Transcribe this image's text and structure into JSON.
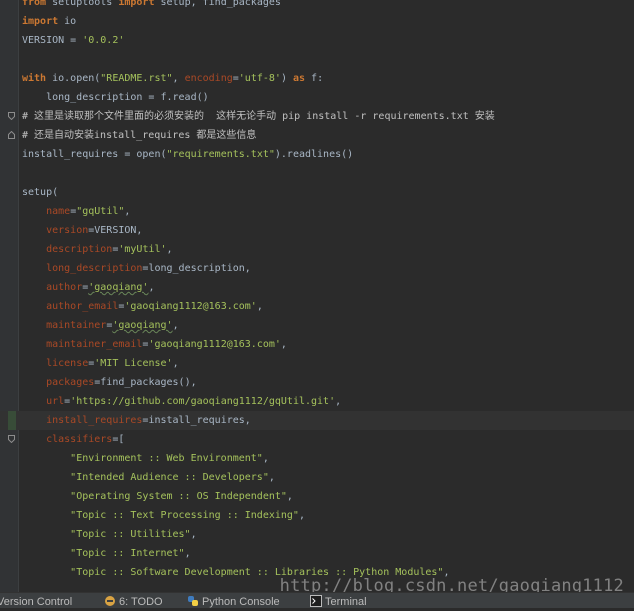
{
  "editor": {
    "lines": {
      "l1": {
        "kw1": "from",
        "t1": " setuptools ",
        "kw2": "import",
        "t2": " setup, find_packages"
      },
      "l2": {
        "kw1": "import",
        "t1": " io"
      },
      "l3": {
        "t1": "VERSION = ",
        "s1": "'0.0.2'"
      },
      "l5": {
        "kw1": "with",
        "t1": " io.open(",
        "s1": "\"README.rst\"",
        "t2": ", ",
        "p1": "encoding",
        "t3": "=",
        "s2": "'utf-8'",
        "t4": ") ",
        "kw2": "as",
        "t5": " f:"
      },
      "l6": {
        "t1": "    long_description = f.read()"
      },
      "l7": {
        "c1": "# 这里是读取那个文件里面的必须安装的  这样无论手动 pip install -r requirements.txt 安装"
      },
      "l8": {
        "c1": "# 还是自动安装install_requires 都是这些信息"
      },
      "l9": {
        "t1": "install_requires = ",
        "b1": "open",
        "t2": "(",
        "s1": "\"requirements.txt\"",
        "t3": ").readlines()"
      },
      "l11": {
        "t1": "setup("
      },
      "l12": {
        "p1": "name",
        "t1": "=",
        "s1": "\"gqUtil\"",
        "t2": ","
      },
      "l13": {
        "p1": "version",
        "t1": "=VERSION,"
      },
      "l14": {
        "p1": "description",
        "t1": "=",
        "s1": "'myUtil'",
        "t2": ","
      },
      "l15": {
        "p1": "long_description",
        "t1": "=long_description,"
      },
      "l16": {
        "p1": "author",
        "t1": "=",
        "s1": "'gaoqiang'",
        "t2": ","
      },
      "l17": {
        "p1": "author_email",
        "t1": "=",
        "s1": "'gaoqiang1112@163.com'",
        "t2": ","
      },
      "l18": {
        "p1": "maintainer",
        "t1": "=",
        "s1": "'gaoqiang'",
        "t2": ","
      },
      "l19": {
        "p1": "maintainer_email",
        "t1": "=",
        "s1": "'gaoqiang1112@163.com'",
        "t2": ","
      },
      "l20": {
        "p1": "license",
        "t1": "=",
        "s1": "'MIT License'",
        "t2": ","
      },
      "l21": {
        "p1": "packages",
        "t1": "=find_packages(),"
      },
      "l22": {
        "p1": "url",
        "t1": "=",
        "s1": "'https://github.com/gaoqiang1112/gqUtil.git'",
        "t2": ","
      },
      "l23": {
        "p1": "install_requires",
        "t1": "=install_requires,"
      },
      "l24": {
        "p1": "classifiers",
        "t1": "=["
      },
      "l25": {
        "s1": "\"Environment :: Web Environment\"",
        "t1": ","
      },
      "l26": {
        "s1": "\"Intended Audience :: Developers\"",
        "t1": ","
      },
      "l27": {
        "s1": "\"Operating System :: OS Independent\"",
        "t1": ","
      },
      "l28": {
        "s1": "\"Topic :: Text Processing :: Indexing\"",
        "t1": ","
      },
      "l29": {
        "s1": "\"Topic :: Utilities\"",
        "t1": ","
      },
      "l30": {
        "s1": "\"Topic :: Internet\"",
        "t1": ","
      },
      "l31": {
        "s1": "\"Topic :: Software Development :: Libraries :: Python Modules\"",
        "t1": ","
      }
    }
  },
  "watermark": "http://blog.csdn.net/gaoqiang1112",
  "statusbar": {
    "version_control": "Version Control",
    "todo": "6: TODO",
    "python_console": "Python Console",
    "terminal": "Terminal"
  },
  "icons": {
    "fold": "fold-marker-icon",
    "todo": "todo-icon",
    "python": "python-console-icon",
    "terminal": "terminal-icon"
  },
  "colors": {
    "background": "#2b2b2b",
    "keyword": "#cc7832",
    "string": "#a5c25c",
    "param": "#aa4926",
    "text": "#a9b7c6"
  }
}
